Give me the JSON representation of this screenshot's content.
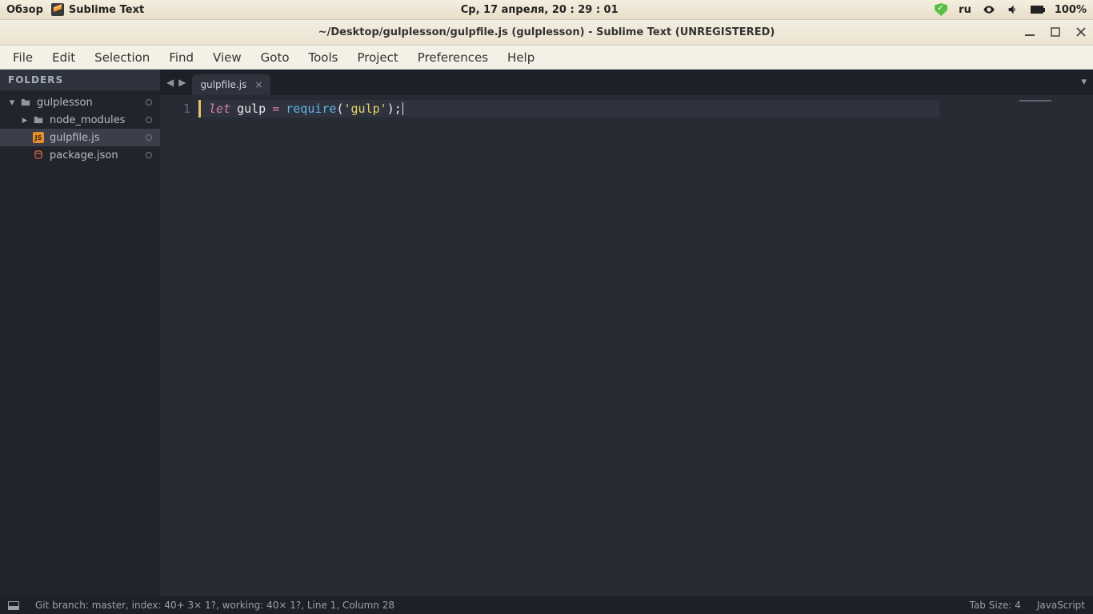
{
  "os_panel": {
    "overview": "Обзор",
    "app_name": "Sublime Text",
    "datetime": "Ср, 17 апреля, 20 : 29 : 01",
    "lang": "ru",
    "battery_pct": "100%"
  },
  "window": {
    "title": "~/Desktop/gulplesson/gulpfile.js (gulplesson) - Sublime Text (UNREGISTERED)"
  },
  "menubar": [
    "File",
    "Edit",
    "Selection",
    "Find",
    "View",
    "Goto",
    "Tools",
    "Project",
    "Preferences",
    "Help"
  ],
  "sidebar": {
    "header": "FOLDERS",
    "root": "gulplesson",
    "items": [
      {
        "name": "node_modules",
        "kind": "folder"
      },
      {
        "name": "gulpfile.js",
        "kind": "js",
        "active": true
      },
      {
        "name": "package.json",
        "kind": "json"
      }
    ]
  },
  "tabs": {
    "active": "gulpfile.js"
  },
  "code": {
    "line_no": "1",
    "tokens": {
      "kw": "let",
      "ident": "gulp",
      "op": "=",
      "fn": "require",
      "lpar": "(",
      "str": "'gulp'",
      "rpar": ")",
      "semi": ";"
    }
  },
  "statusbar": {
    "git": "Git branch: master, index: 40+ 3× 1?, working: 40× 1?, Line 1, Column 28",
    "tab_size": "Tab Size: 4",
    "syntax": "JavaScript"
  }
}
